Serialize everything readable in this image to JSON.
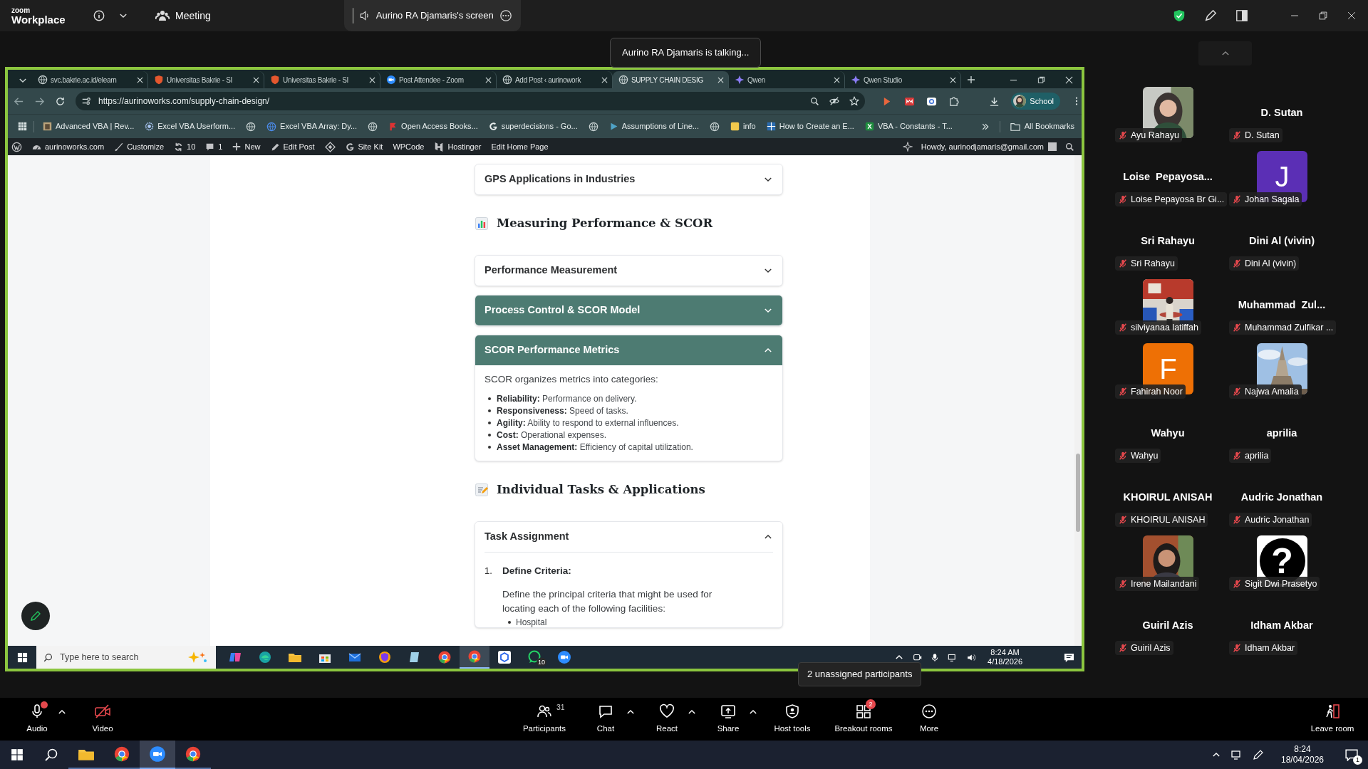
{
  "top_bar": {
    "logo_small": "zoom",
    "logo_large": "Workplace",
    "meeting_label": "Meeting",
    "shared_screen_tab": "Aurino RA Djamaris's screen"
  },
  "talking_indicator": "Aurino RA Djamaris is talking...",
  "browser": {
    "tabs": [
      {
        "title": "svc.bakrie.ac.id/elearn",
        "kind": "globe",
        "selected": false
      },
      {
        "title": "Universitas Bakrie - SI",
        "kind": "orange",
        "selected": false
      },
      {
        "title": "Universitas Bakrie - SI",
        "kind": "orange",
        "selected": false
      },
      {
        "title": "Post Attendee - Zoom",
        "kind": "zoom",
        "selected": false
      },
      {
        "title": "Add Post ‹ aurinowork",
        "kind": "globe",
        "selected": false
      },
      {
        "title": "SUPPLY CHAIN DESIG",
        "kind": "globe",
        "selected": true
      },
      {
        "title": "Qwen",
        "kind": "qwen",
        "selected": false
      },
      {
        "title": "Qwen Studio",
        "kind": "qwen",
        "selected": false
      }
    ],
    "url": "https://aurinoworks.com/supply-chain-design/",
    "profile": "School",
    "bookmarks": [
      {
        "kind": "thumb",
        "label": "Advanced VBA | Rev..."
      },
      {
        "kind": "badge",
        "label": "Excel VBA Userform..."
      },
      {
        "kind": "globe"
      },
      {
        "kind": "blue",
        "label": "Excel VBA Array: Dy..."
      },
      {
        "kind": "globe"
      },
      {
        "kind": "red",
        "label": "Open Access Books..."
      },
      {
        "kind": "google",
        "label": "superdecisions - Go..."
      },
      {
        "kind": "globe"
      },
      {
        "kind": "play",
        "label": "Assumptions of Line..."
      },
      {
        "kind": "globe"
      },
      {
        "kind": "yellow",
        "label": "info"
      },
      {
        "kind": "puzzle",
        "label": "How to Create an E..."
      },
      {
        "kind": "excel",
        "label": "VBA - Constants - T..."
      }
    ],
    "all_bookmarks": "All Bookmarks"
  },
  "admin_bar": {
    "items": [
      {
        "kind": "wp"
      },
      {
        "kind": "site",
        "label": "aurinoworks.com"
      },
      {
        "kind": "brush",
        "label": "Customize"
      },
      {
        "kind": "updates",
        "label": "10"
      },
      {
        "kind": "comments",
        "label": "1"
      },
      {
        "kind": "plus",
        "label": "New"
      },
      {
        "kind": "pencil",
        "label": "Edit Post"
      },
      {
        "kind": "diamond"
      },
      {
        "kind": "g",
        "label": "Site Kit"
      },
      {
        "kind": "plain",
        "label": "WPCode"
      },
      {
        "kind": "hostinger",
        "label": "Hostinger"
      },
      {
        "kind": "plain",
        "label": "Edit Home Page"
      }
    ],
    "greeting": "Howdy, aurinodjamaris@gmail.com"
  },
  "page": {
    "sections": [
      {
        "kind": "accordion",
        "title": "GPS Applications in Industries",
        "active": false,
        "expanded": false
      },
      {
        "kind": "heading",
        "title": "Measuring Performance & SCOR"
      },
      {
        "kind": "accordion",
        "title": "Performance Measurement",
        "active": false,
        "expanded": false
      },
      {
        "kind": "accordion",
        "title": "Process Control & SCOR Model",
        "active": true,
        "expanded": false
      },
      {
        "kind": "accordion",
        "title": "SCOR Performance Metrics",
        "active": true,
        "expanded": true,
        "body": {
          "intro": "SCOR organizes metrics into categories:",
          "bullets": [
            "**Reliability:** Performance on delivery.",
            "**Responsiveness:** Speed of tasks.",
            "**Agility:** Ability to respond to external influences.",
            "**Cost:** Operational expenses.",
            "**Asset Management:** Efficiency of capital utilization."
          ]
        }
      },
      {
        "kind": "heading",
        "title": "Individual Tasks & Applications"
      },
      {
        "kind": "accordion",
        "title": "Task Assignment",
        "active": false,
        "expanded": true,
        "steps": [
          {
            "number": "1.",
            "title": "Define Criteria:",
            "text": "Define the principal criteria that might be used for locating each of the following facilities:",
            "bullets": [
              "Hospital"
            ]
          }
        ]
      }
    ]
  },
  "shared_taskbar": {
    "search_placeholder": "Type here to search",
    "apps": [
      {
        "kind": "copilot",
        "selected": false
      },
      {
        "kind": "edge",
        "selected": false
      },
      {
        "kind": "folder",
        "selected": false
      },
      {
        "kind": "store",
        "selected": false
      },
      {
        "kind": "mail",
        "selected": false
      },
      {
        "kind": "brave",
        "selected": false
      },
      {
        "kind": "notes",
        "selected": false
      },
      {
        "kind": "chrome",
        "selected": false
      },
      {
        "kind": "chrome",
        "selected": true
      },
      {
        "kind": "cube",
        "selected": false
      },
      {
        "kind": "whatsapp",
        "selected": false,
        "badge": "10"
      },
      {
        "kind": "zoom",
        "selected": false
      }
    ],
    "time": "8:24 AM",
    "date": "4/18/2026"
  },
  "unassigned_notice": "2 unassigned participants",
  "participants": [
    {
      "kind": "picture",
      "label": "Ayu Rahayu",
      "muted": true
    },
    {
      "kind": "name",
      "display_name": "D. Sutan",
      "label": "D. Sutan",
      "muted": true
    },
    {
      "kind": "name",
      "display_name": "Loise  Pepayosa...",
      "label": "Loise Pepayosa Br Gi...",
      "muted": true
    },
    {
      "kind": "letter",
      "letter": "J",
      "color": "#5b2fb5",
      "label": "Johan Sagala",
      "muted": true
    },
    {
      "kind": "name",
      "display_name": "Sri Rahayu",
      "label": "Sri Rahayu",
      "muted": true
    },
    {
      "kind": "name",
      "display_name": "Dini Al (vivin)",
      "label": "Dini Al (vivin)",
      "muted": true
    },
    {
      "kind": "picture",
      "label": "silviyanaa latiffah",
      "muted": true
    },
    {
      "kind": "name",
      "display_name": "Muhammad  Zul...",
      "label": "Muhammad Zulfikar ...",
      "muted": true
    },
    {
      "kind": "letter",
      "letter": "F",
      "color": "#ee7005",
      "label": "Fahirah Noor",
      "muted": true
    },
    {
      "kind": "picture",
      "label": "Najwa Amalia",
      "muted": true
    },
    {
      "kind": "name",
      "display_name": "Wahyu",
      "label": "Wahyu",
      "muted": true
    },
    {
      "kind": "name",
      "display_name": "aprilia",
      "label": "aprilia",
      "muted": true
    },
    {
      "kind": "name",
      "display_name": "KHOIRUL ANISAH",
      "label": "KHOIRUL ANISAH",
      "muted": true
    },
    {
      "kind": "name",
      "display_name": "Audric Jonathan",
      "label": "Audric Jonathan",
      "muted": true
    },
    {
      "kind": "picture",
      "label": "Irene Mailandani",
      "muted": true
    },
    {
      "kind": "glyph",
      "glyph": "?",
      "label": "Sigit Dwi Prasetyo",
      "muted": true
    },
    {
      "kind": "name",
      "display_name": "Guiril Azis",
      "label": "Guiril Azis",
      "muted": true
    },
    {
      "kind": "name",
      "display_name": "Idham Akbar",
      "label": "Idham Akbar",
      "muted": true
    }
  ],
  "toolbar": [
    {
      "kind": "audio",
      "label": "Audio",
      "has_menu": true
    },
    {
      "kind": "video_off",
      "label": "Video",
      "has_menu": false
    },
    {
      "kind": "participants",
      "label": "Participants",
      "count": "31",
      "has_menu": false
    },
    {
      "kind": "chat",
      "label": "Chat",
      "has_menu": true
    },
    {
      "kind": "react",
      "label": "React",
      "has_menu": true
    },
    {
      "kind": "share",
      "label": "Share",
      "has_menu": true
    },
    {
      "kind": "host",
      "label": "Host tools",
      "has_menu": false
    },
    {
      "kind": "breakout",
      "label": "Breakout rooms",
      "badge": "2",
      "has_menu": false
    },
    {
      "kind": "more",
      "label": "More",
      "has_menu": false
    },
    {
      "kind": "leave",
      "label": "Leave room",
      "has_menu": false
    }
  ],
  "taskbar": {
    "apps": [
      {
        "kind": "folder",
        "selected": false
      },
      {
        "kind": "chrome",
        "selected": false
      },
      {
        "kind": "zoom",
        "selected": true
      },
      {
        "kind": "chrome",
        "selected": false
      }
    ],
    "time": "8:24",
    "date": "18/04/2026",
    "notifications": "1"
  }
}
